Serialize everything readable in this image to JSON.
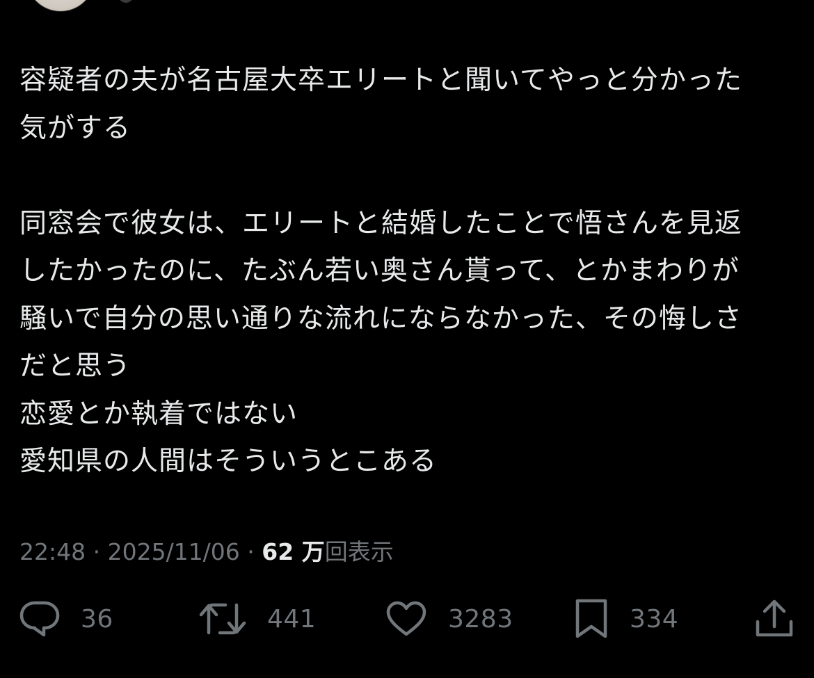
{
  "tweet": {
    "lines_para1": [
      "容疑者の夫が名古屋大卒エリートと聞いてやっと分かった",
      "気がする"
    ],
    "lines_para2": [
      "同窓会で彼女は、エリートと結婚したことで悟さんを見返",
      "したかったのに、たぶん若い奥さん貰って、とかまわりが",
      "騒いで自分の思い通りな流れにならなかった、その悔しさ",
      "だと思う",
      "恋愛とか執着ではない",
      "愛知県の人間はそういうとこある"
    ]
  },
  "meta": {
    "time": "22:48",
    "separator": " · ",
    "date": "2025/11/06",
    "views_count": "62 万",
    "views_label": "回表示"
  },
  "actions": {
    "reply_count": "36",
    "repost_count": "441",
    "like_count": "3283",
    "bookmark_count": "334",
    "reply_icon": "reply-bubble-icon",
    "repost_icon": "repost-arrows-icon",
    "like_icon": "heart-icon",
    "bookmark_icon": "bookmark-icon",
    "share_icon": "share-upload-icon"
  },
  "colors": {
    "background": "#000000",
    "text": "#e7e9ea",
    "muted": "#71767b"
  }
}
